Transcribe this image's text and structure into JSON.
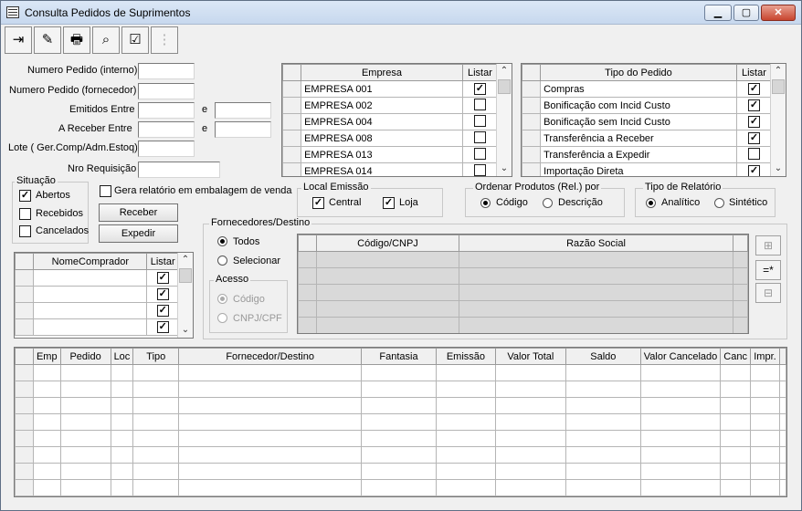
{
  "window": {
    "title": "Consulta Pedidos de Suprimentos",
    "min": "▁",
    "max": "▢",
    "close": "✕"
  },
  "toolbar": [
    {
      "name": "exit-icon",
      "glyph": "⇥"
    },
    {
      "name": "eraser-icon",
      "glyph": "✎"
    },
    {
      "name": "printer-icon",
      "glyph": "🖶"
    },
    {
      "name": "binoculars-icon",
      "glyph": "⌕"
    },
    {
      "name": "checklist-icon",
      "glyph": "☑"
    },
    {
      "name": "tree-icon",
      "glyph": "⋮"
    }
  ],
  "filters": {
    "numero_pedido_interno": "Numero Pedido (interno)",
    "numero_pedido_fornecedor": "Numero Pedido (fornecedor)",
    "emitidos_entre": "Emitidos Entre",
    "a_receber_entre": "A Receber Entre",
    "e": "e",
    "lote": "Lote ( Ger.Comp/Adm.Estoq)",
    "nro_requisicao": "Nro Requisição"
  },
  "situacao": {
    "title": "Situação",
    "abertos": "Abertos",
    "recebidos": "Recebidos",
    "cancelados": "Cancelados"
  },
  "gera_relatorio": "Gera relatório em embalagem de venda",
  "buttons": {
    "receber": "Receber",
    "expedir": "Expedir"
  },
  "empresa_grid": {
    "col_empresa": "Empresa",
    "col_listar": "Listar",
    "rows": [
      {
        "name": "EMPRESA 001",
        "checked": true
      },
      {
        "name": "EMPRESA 002",
        "checked": false
      },
      {
        "name": "EMPRESA 004",
        "checked": false
      },
      {
        "name": "EMPRESA 008",
        "checked": false
      },
      {
        "name": "EMPRESA 013",
        "checked": false
      },
      {
        "name": "EMPRESA 014",
        "checked": false
      }
    ]
  },
  "tipo_grid": {
    "col_tipo": "Tipo do Pedido",
    "col_listar": "Listar",
    "rows": [
      {
        "name": "Compras",
        "checked": true
      },
      {
        "name": "Bonificação com Incid Custo",
        "checked": true
      },
      {
        "name": "Bonificação sem Incid Custo",
        "checked": true
      },
      {
        "name": "Transferência a Receber",
        "checked": true
      },
      {
        "name": "Transferência a Expedir",
        "checked": false
      },
      {
        "name": "Importação Direta",
        "checked": true
      }
    ]
  },
  "local_emissao": {
    "title": "Local Emissão",
    "central": "Central",
    "loja": "Loja"
  },
  "ordenar": {
    "title": "Ordenar Produtos (Rel.) por",
    "codigo": "Código",
    "descricao": "Descrição"
  },
  "tipo_relatorio": {
    "title": "Tipo de Relatório",
    "analitico": "Analítico",
    "sintetico": "Sintético"
  },
  "fornecedores": {
    "title": "Fornecedores/Destino",
    "todos": "Todos",
    "selecionar": "Selecionar",
    "acesso": "Acesso",
    "codigo": "Código",
    "cnpj_cpf": "CNPJ/CPF",
    "col_codigo": "Código/CNPJ",
    "col_razao": "Razão Social"
  },
  "comprador_grid": {
    "col_nome": "NomeComprador",
    "col_listar": "Listar"
  },
  "main_grid": {
    "columns": [
      "Emp",
      "Pedido",
      "Loc",
      "Tipo",
      "Fornecedor/Destino",
      "Fantasia",
      "Emissão",
      "Valor Total",
      "Saldo",
      "Valor Cancelado",
      "Canc",
      "Impr."
    ]
  }
}
